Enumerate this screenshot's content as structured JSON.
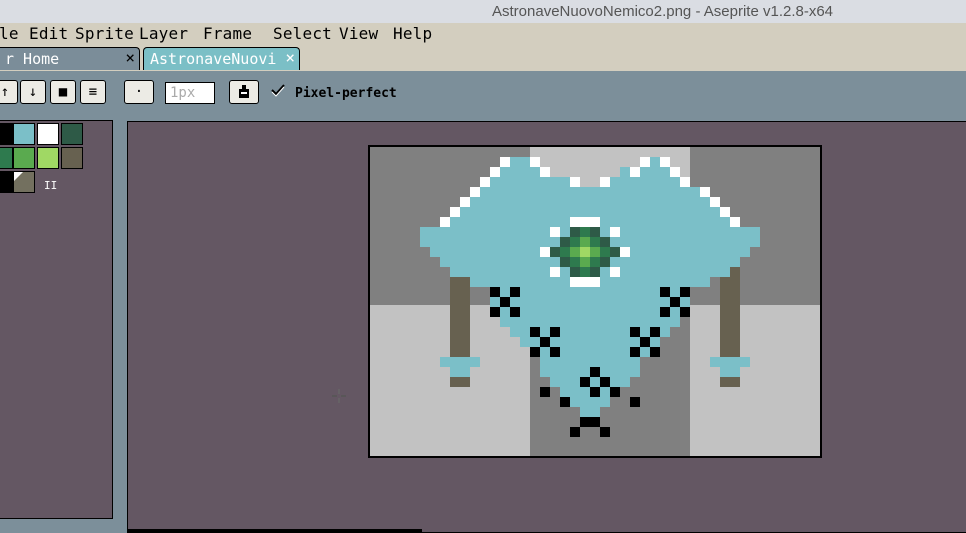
{
  "window": {
    "title": "AstronaveNuovoNemico2.png - Aseprite v1.2.8-x64"
  },
  "menu": {
    "items": [
      {
        "name": "menu-file",
        "label": "le"
      },
      {
        "name": "menu-edit",
        "label": "Edit"
      },
      {
        "name": "menu-sprite",
        "label": "Sprite"
      },
      {
        "name": "menu-layer",
        "label": "Layer"
      },
      {
        "name": "menu-frame",
        "label": "Frame"
      },
      {
        "name": "menu-select",
        "label": "Select"
      },
      {
        "name": "menu-view",
        "label": "View"
      },
      {
        "name": "menu-help",
        "label": "Help"
      }
    ]
  },
  "tabs": [
    {
      "label": "r Home",
      "close": "×"
    },
    {
      "label": "AstronaveNuovi",
      "close": "×"
    }
  ],
  "toolbar": {
    "buttons": [
      {
        "icon": "move-up-icon",
        "glyph": "↑"
      },
      {
        "icon": "move-down-icon",
        "glyph": "↓"
      },
      {
        "icon": "stop-icon",
        "glyph": "■"
      },
      {
        "icon": "menu-lines-icon",
        "glyph": "≡"
      },
      {
        "icon": "brush-type-dot-icon",
        "glyph": "·"
      }
    ],
    "brush_size": "1px",
    "ink_icon": "ink-bottle-icon",
    "pixel_perfect_checked": true,
    "pixel_perfect_label": "Pixel-perfect"
  },
  "palette": {
    "colors": [
      "#000000",
      "#7bbfc8",
      "#ffffff",
      "#2e5a47",
      "#2e7a4e",
      "#5aaa4f",
      "#a0d864",
      "#676150",
      "#000000",
      "#73705f"
    ],
    "scroll_handle": "II"
  },
  "sprite": {
    "colors": {
      "bg_light": "#c2c2c2",
      "bg_dark": "#808080",
      "body": "#7bbfc8",
      "leg": "#676150",
      "gem_dark": "#2e5a47",
      "gem_mid": "#2e7a4e",
      "gem_light": "#5aaa4f",
      "gem_core": "#a0d864"
    }
  }
}
